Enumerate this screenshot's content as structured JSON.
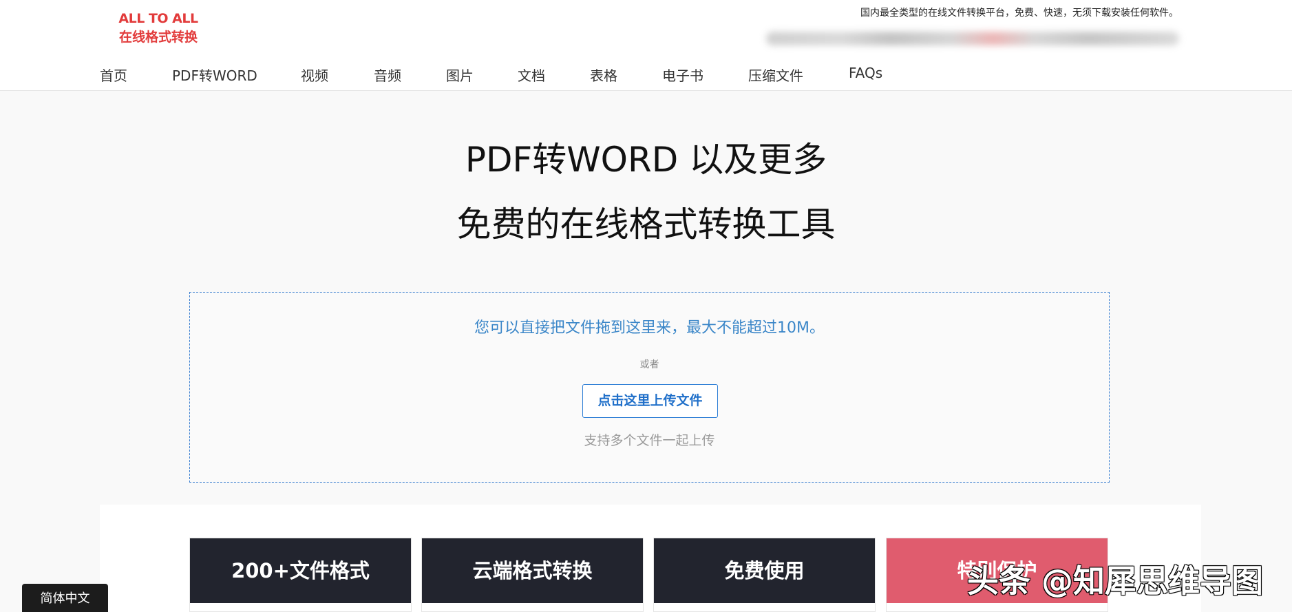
{
  "header": {
    "logo_line1": "ALL TO ALL",
    "logo_line2": "在线格式转换",
    "tagline": "国内最全类型的在线文件转换平台，免费、快速，无须下载安装任何软件。",
    "brand_color": "#e23b3b"
  },
  "nav": {
    "items": [
      "首页",
      "PDF转WORD",
      "视频",
      "音频",
      "图片",
      "文档",
      "表格",
      "电子书",
      "压缩文件",
      "FAQs"
    ]
  },
  "hero": {
    "title_line1": "PDF转WORD 以及更多",
    "title_line2": "免费的在线格式转换工具"
  },
  "dropzone": {
    "hint": "您可以直接把文件拖到这里来，最大不能超过10M。",
    "or": "或者",
    "upload_button": "点击这里上传文件",
    "multi_note": "支持多个文件一起上传",
    "accent_color": "#3a7fd0"
  },
  "features": {
    "cards": [
      "200+文件格式",
      "云端格式转换",
      "免费使用",
      "特别保护"
    ],
    "dark_color": "#22242e",
    "highlight_color": "#e05c6e"
  },
  "watermark": "头条 @知犀思维导图",
  "language_selector": "简体中文"
}
